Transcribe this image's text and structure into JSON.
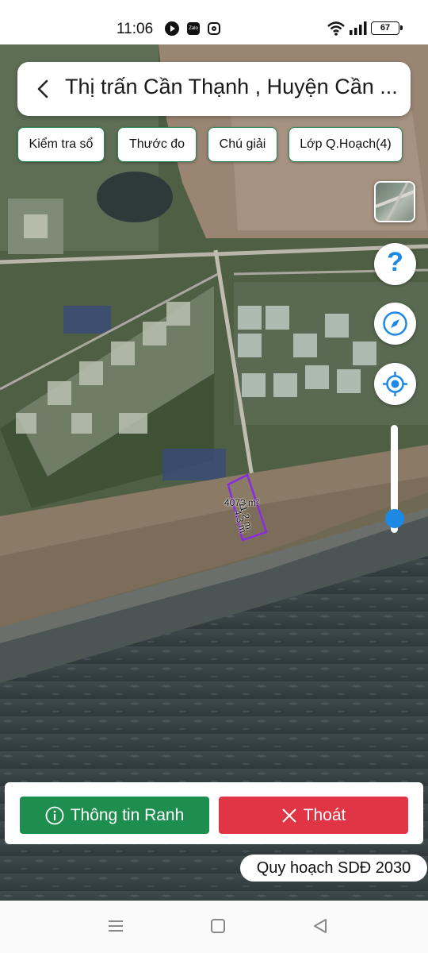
{
  "status_bar": {
    "time": "11:06",
    "apps": [
      "youtube-icon",
      "zalo-icon",
      "instagram-icon"
    ],
    "zalo_text": "Zalo",
    "battery": "67"
  },
  "header": {
    "title": "Thị trấn Cần Thạnh , Huyện Cần ..."
  },
  "toolbar": {
    "chips": [
      {
        "label": "Kiểm tra sổ"
      },
      {
        "label": "Thước đo"
      },
      {
        "label": "Chú giải"
      },
      {
        "label": "Lớp Q.Hoạch(4)"
      }
    ]
  },
  "map_controls": {
    "help_label": "?",
    "zoom_level": 0.05
  },
  "parcel": {
    "area": "4073 m²",
    "edge_1": "11.2 m",
    "edge_2": "4.3 m",
    "outline_color": "#8a2be2"
  },
  "actions": {
    "info_label": "Thông tin Ranh",
    "exit_label": "Thoát",
    "info_color": "#1e8e4e",
    "exit_color": "#df3545"
  },
  "plan_badge": "Quy hoạch SDĐ 2030"
}
